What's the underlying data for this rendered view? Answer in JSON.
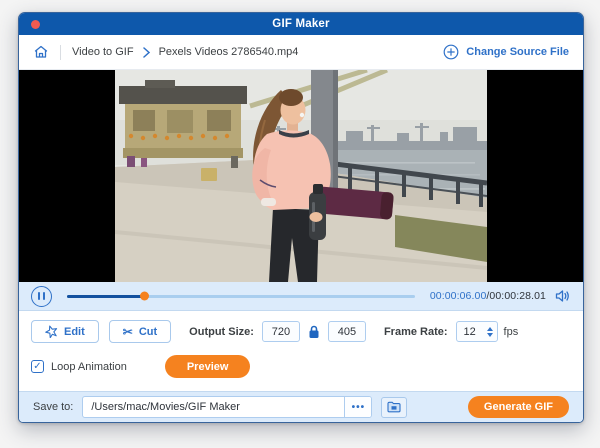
{
  "window": {
    "title": "GIF Maker"
  },
  "breadcrumb": {
    "section": "Video to GIF",
    "file": "Pexels Videos 2786540.mp4",
    "change_source": "Change Source File"
  },
  "player": {
    "current_time": "00:00:06.00",
    "remaining": "/00:00:28.01",
    "progress_pct": 22.4,
    "state": "playing"
  },
  "toolbar": {
    "edit": "Edit",
    "cut": "Cut",
    "output_size_label": "Output Size:",
    "output_width": "720",
    "output_height": "405",
    "size_locked": true,
    "frame_rate_label": "Frame Rate:",
    "frame_rate": "12",
    "fps_label": "fps"
  },
  "options": {
    "loop_label": "Loop Animation",
    "loop_checked": true,
    "check_glyph": "✓",
    "preview": "Preview"
  },
  "save": {
    "label": "Save to:",
    "path": "/Users/mac/Movies/GIF Maker",
    "more": "•••",
    "generate": "Generate GIF"
  },
  "icons": {
    "close": "close-circle",
    "home": "home-icon",
    "chevron": "chevron-right",
    "plus": "plus-circle",
    "pause": "pause-icon",
    "volume": "speaker-icon",
    "edit": "sparkle-star",
    "cut": "scissors",
    "lock": "padlock",
    "folder": "folder"
  },
  "colors": {
    "titlebar_blue": "#0e58ab",
    "accent": "#2f71c8",
    "bar_bg": "#dcebfb",
    "panel_border": "#c3d9f0",
    "field_border": "#aecdef",
    "orange": "#f5821f",
    "slider_fill": "#13519f",
    "slider_track": "#a9ceef",
    "close_red": "#f15b51",
    "window_border": "#38649c",
    "text_dark": "#33373d"
  }
}
